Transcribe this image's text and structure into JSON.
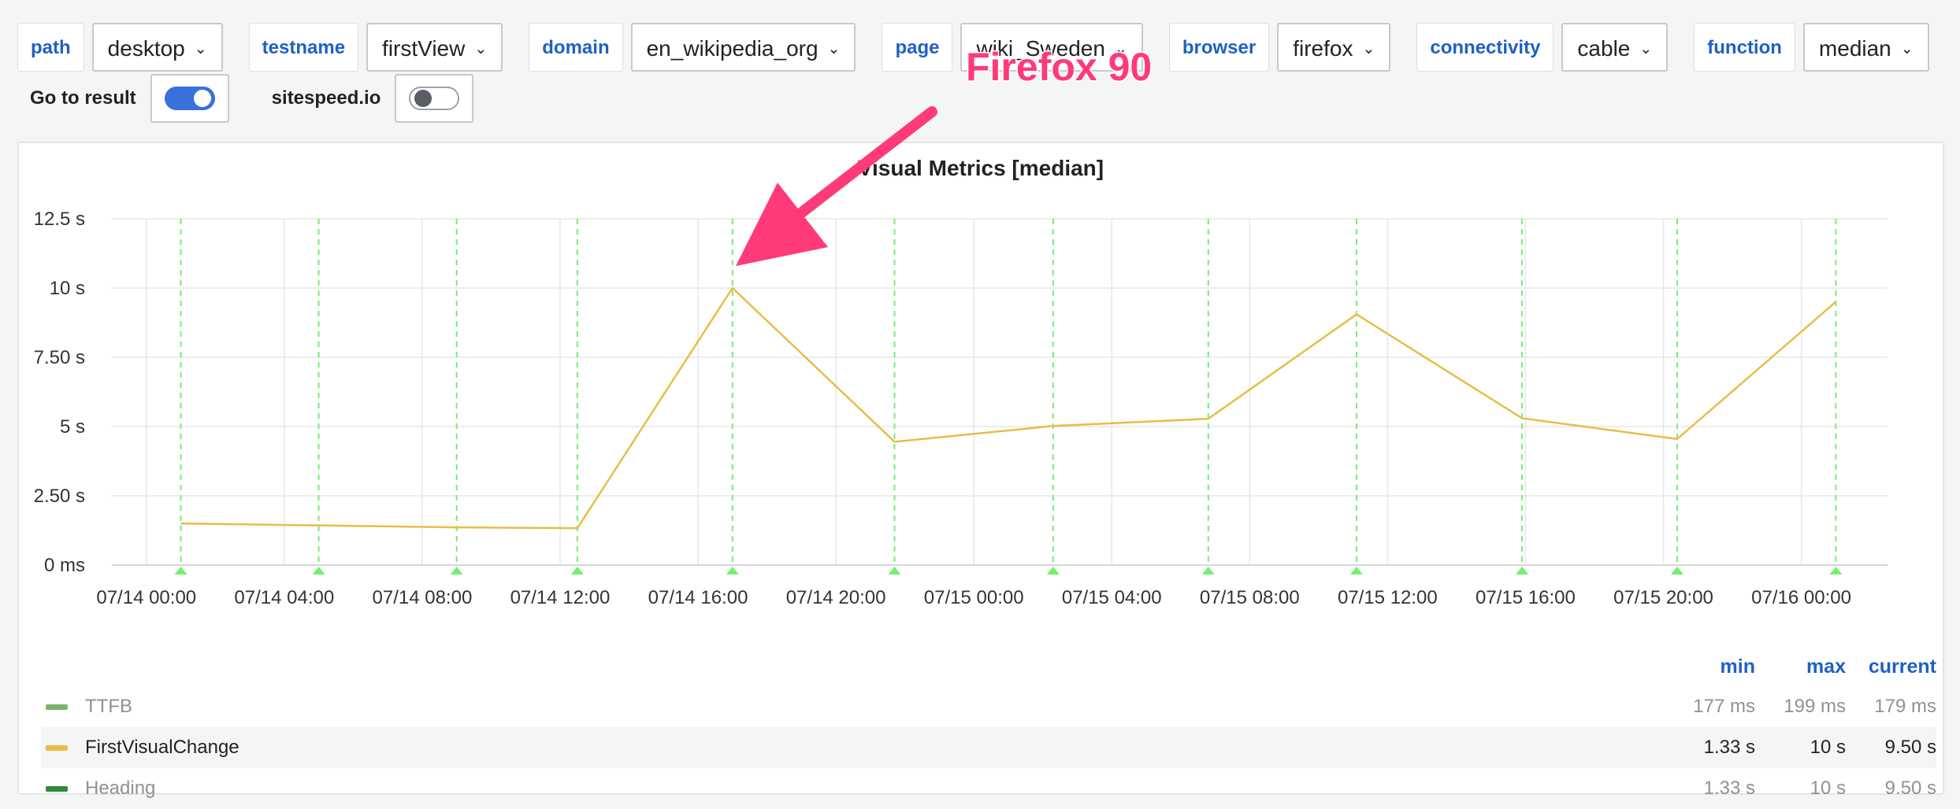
{
  "variables": [
    {
      "label": "path",
      "value": "desktop"
    },
    {
      "label": "testname",
      "value": "firstView"
    },
    {
      "label": "domain",
      "value": "en_wikipedia_org"
    },
    {
      "label": "page",
      "value": "wiki_Sweden"
    },
    {
      "label": "browser",
      "value": "firefox"
    },
    {
      "label": "connectivity",
      "value": "cable"
    },
    {
      "label": "function",
      "value": "median"
    }
  ],
  "toggles": [
    {
      "label": "Go to result",
      "on": true
    },
    {
      "label": "sitespeed.io",
      "on": false
    }
  ],
  "annotation_text": "Firefox 90",
  "panel": {
    "title": "Visual Metrics [median]"
  },
  "chart_data": {
    "type": "line",
    "title": "Visual Metrics [median]",
    "y_ticks": [
      "0 ms",
      "2.50 s",
      "5 s",
      "7.50 s",
      "10 s",
      "12.5 s"
    ],
    "ylim": [
      0,
      12.5
    ],
    "x_ticks": [
      "07/14 00:00",
      "07/14 04:00",
      "07/14 08:00",
      "07/14 12:00",
      "07/14 16:00",
      "07/14 20:00",
      "07/15 00:00",
      "07/15 04:00",
      "07/15 08:00",
      "07/15 12:00",
      "07/15 16:00",
      "07/15 20:00",
      "07/16 00:00"
    ],
    "x_tick_hours": [
      0,
      4,
      8,
      12,
      16,
      20,
      24,
      28,
      32,
      36,
      40,
      44,
      48
    ],
    "xlim_hours": [
      -1,
      50.5
    ],
    "series": [
      {
        "name": "FirstVisualChange",
        "color": "#e8bd48",
        "x_hours": [
          1,
          5,
          9,
          12.5,
          17,
          21.7,
          26.3,
          30.8,
          35.1,
          39.9,
          44.4,
          49
        ],
        "values": [
          1.5,
          1.43,
          1.36,
          1.33,
          10,
          4.45,
          5.02,
          5.28,
          9.05,
          5.3,
          4.55,
          9.5
        ]
      }
    ],
    "annotation_hours": [
      1,
      5,
      9,
      12.5,
      17,
      21.7,
      26.3,
      30.8,
      35.1,
      39.9,
      44.4,
      49
    ],
    "annotation_color": "#73f06f",
    "grid": true
  },
  "legend": {
    "headers": {
      "min": "min",
      "max": "max",
      "current": "current"
    },
    "rows": [
      {
        "name": "TTFB",
        "color": "#7eb26d",
        "min": "177 ms",
        "max": "199 ms",
        "current": "179 ms",
        "dim": true
      },
      {
        "name": "FirstVisualChange",
        "color": "#e8bd48",
        "min": "1.33 s",
        "max": "10 s",
        "current": "9.50 s",
        "dim": false
      },
      {
        "name": "Heading",
        "color": "#2f8a39",
        "min": "1.33 s",
        "max": "10 s",
        "current": "9.50 s",
        "dim": true
      }
    ]
  },
  "colors": {
    "accent": "#1f60c4",
    "annotation_arrow": "#ff3a79"
  }
}
